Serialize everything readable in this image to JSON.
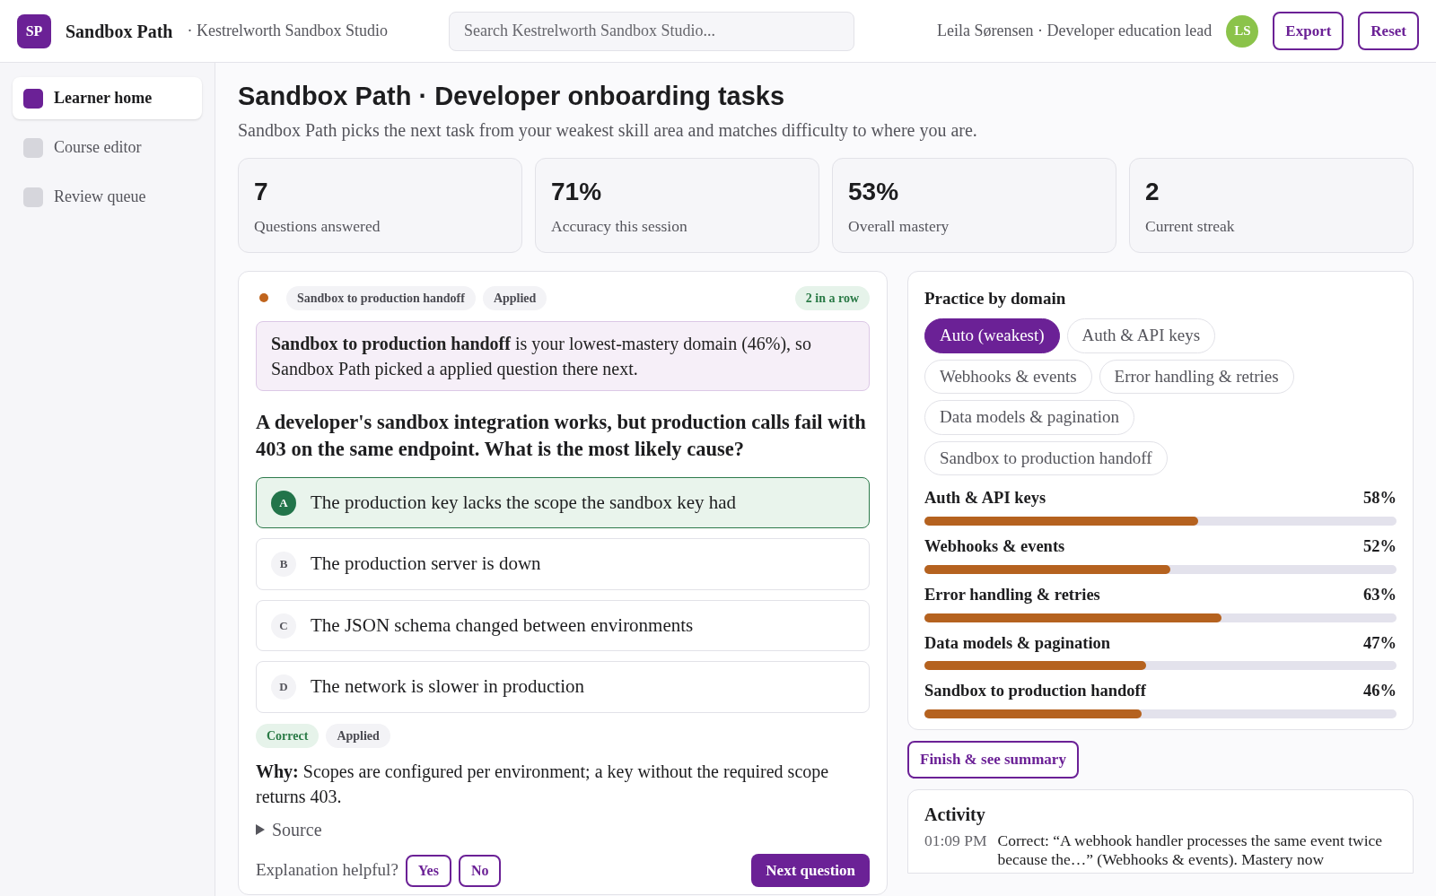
{
  "app": {
    "logo": "SP",
    "name": "Sandbox Path",
    "org": "· Kestrelworth Sandbox Studio"
  },
  "search": {
    "placeholder": "Search Kestrelworth Sandbox Studio..."
  },
  "user": {
    "name_role": "Leila Sørensen · Developer education lead",
    "initials": "LS"
  },
  "header_buttons": [
    "Export",
    "Reset"
  ],
  "sidebar": {
    "items": [
      {
        "label": "Learner home",
        "selected": true
      },
      {
        "label": "Course editor",
        "selected": false
      },
      {
        "label": "Review queue",
        "selected": false
      }
    ]
  },
  "page": {
    "title": "Sandbox Path · Developer onboarding tasks",
    "subtitle": "Sandbox Path picks the next task from your weakest skill area and matches difficulty to where you are."
  },
  "stats": [
    {
      "value": "7",
      "label": "Questions answered"
    },
    {
      "value": "71%",
      "label": "Accuracy this session"
    },
    {
      "value": "53%",
      "label": "Overall mastery"
    },
    {
      "value": "2",
      "label": "Current streak"
    }
  ],
  "question": {
    "tags": [
      "Sandbox to production handoff",
      "Applied"
    ],
    "streak": "2 in a row",
    "notice": "**Sandbox to production handoff** is your lowest-mastery domain (46%), so Sandbox Path picked a applied question there next.",
    "prompt": "A developer's sandbox integration works, but production calls fail with 403 on the same endpoint. What is the most likely cause?",
    "options": [
      {
        "letter": "A",
        "text": "The production key lacks the scope the sandbox key had",
        "selected": true
      },
      {
        "letter": "B",
        "text": "The production server is down",
        "selected": false
      },
      {
        "letter": "C",
        "text": "The JSON schema changed between environments",
        "selected": false
      },
      {
        "letter": "D",
        "text": "The network is slower in production",
        "selected": false
      }
    ],
    "result_tags": [
      {
        "text": "Correct",
        "kind": "correct"
      },
      {
        "text": "Applied",
        "kind": "level"
      }
    ],
    "why": "**Why:** Scopes are configured per environment; a key without the required scope returns 403.",
    "source": {
      "label": "Source",
      "expanded": false
    },
    "feedback": {
      "prompt": "Explanation helpful?",
      "buttons": [
        "Yes",
        "No"
      ]
    },
    "next_button": "Next question"
  },
  "practice": {
    "title": "Practice by domain",
    "filters": [
      {
        "label": "Auto (weakest)",
        "selected": true
      },
      {
        "label": "Auth & API keys",
        "selected": false
      },
      {
        "label": "Webhooks & events",
        "selected": false
      },
      {
        "label": "Error handling & retries",
        "selected": false
      },
      {
        "label": "Data models & pagination",
        "selected": false
      },
      {
        "label": "Sandbox to production handoff",
        "selected": false
      }
    ],
    "domains": [
      {
        "name": "Auth & API keys",
        "reading": "58%",
        "level": 0.58
      },
      {
        "name": "Webhooks & events",
        "reading": "52%",
        "level": 0.52
      },
      {
        "name": "Error handling & retries",
        "reading": "63%",
        "level": 0.63
      },
      {
        "name": "Data models & pagination",
        "reading": "47%",
        "level": 0.47
      },
      {
        "name": "Sandbox to production handoff",
        "reading": "46%",
        "level": 0.46
      }
    ]
  },
  "finish_button": "Finish & see summary",
  "activity": {
    "title": "Activity",
    "entries": [
      {
        "time": "01:09 PM",
        "text": "Correct: “A webhook handler processes the same event twice because the…” (Webhooks & events). Mastery now"
      }
    ]
  }
}
